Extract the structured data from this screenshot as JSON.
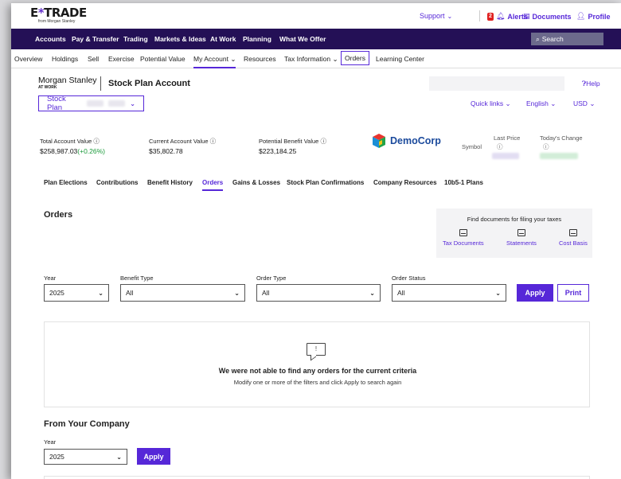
{
  "brand": {
    "logo_prefix": "E",
    "logo_star": "*",
    "logo_suffix": "TRADE",
    "logo_sub": "from Morgan Stanley",
    "accent": "#5627d8",
    "nav_bg": "#241056"
  },
  "utility": {
    "support": "Support",
    "alerts_count": "2",
    "alerts": "Alerts",
    "documents": "Documents",
    "profile": "Profile"
  },
  "nav": {
    "items": [
      "Accounts",
      "Pay & Transfer",
      "Trading",
      "Markets & Ideas",
      "At Work",
      "Planning",
      "What We Offer"
    ],
    "search_placeholder": "Search"
  },
  "subnav": {
    "items": [
      "Overview",
      "Holdings",
      "Sell",
      "Exercise",
      "Potential Value",
      "My Account",
      "Resources",
      "Tax Information",
      "Orders",
      "Learning Center"
    ]
  },
  "account": {
    "ms_name": "Morgan Stanley",
    "ms_sub": "AT WORK",
    "title": "Stock Plan Account",
    "help": "Help",
    "plan_label": "Stock Plan",
    "quick_links": "Quick links",
    "language": "English",
    "currency": "USD"
  },
  "stats": {
    "total_label": "Total Account Value",
    "total_value": "$258,987.03",
    "total_change": "(+0.26%)",
    "current_label": "Current Account Value",
    "current_value": "$35,802.78",
    "potential_label": "Potential Benefit Value",
    "potential_value": "$223,184.25",
    "company": "DemoCorp",
    "symbol_label": "Symbol",
    "last_price_label": "Last Price",
    "todays_change_label": "Today's Change"
  },
  "tabs": [
    "Plan Elections",
    "Contributions",
    "Benefit History",
    "Orders",
    "Gains & Losses",
    "Stock Plan Confirmations",
    "Company Resources",
    "10b5-1 Plans"
  ],
  "orders": {
    "title": "Orders",
    "tax_title": "Find documents for filing your taxes",
    "tax_links": [
      "Tax Documents",
      "Statements",
      "Cost Basis"
    ],
    "filters": {
      "year_label": "Year",
      "year_value": "2025",
      "benefit_label": "Benefit Type",
      "benefit_value": "All",
      "order_type_label": "Order Type",
      "order_type_value": "All",
      "status_label": "Order Status",
      "status_value": "All"
    },
    "apply": "Apply",
    "print": "Print",
    "empty_title": "We were not able to find any orders for the current criteria",
    "empty_sub": "Modify one or more of the filters and click Apply to search again"
  },
  "company_section": {
    "title": "From Your Company",
    "year_label": "Year",
    "year_value": "2025",
    "apply": "Apply"
  }
}
